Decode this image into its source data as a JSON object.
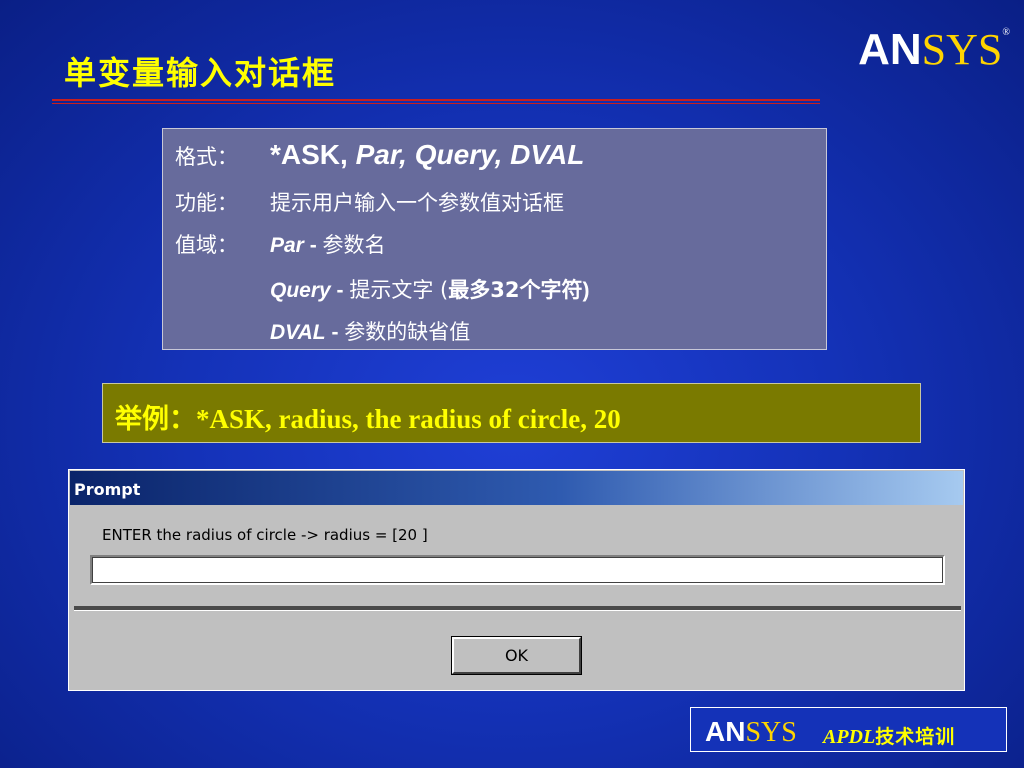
{
  "slide": {
    "title": "单变量输入对话框",
    "logo": {
      "an": "AN",
      "sys": "SYS",
      "mark": "®"
    }
  },
  "info": {
    "format_label": "格式：",
    "format_cmd": "*ASK,",
    "format_args": "Par, Query, DVAL",
    "function_label": "功能：",
    "function_text": "提示用户输入一个参数值对话框",
    "range_label": "值域：",
    "par_name": "Par",
    "par_sep": " - ",
    "par_desc": "参数名",
    "query_name": "Query",
    "query_sep": " - ",
    "query_desc": "提示文字 (",
    "query_desc_bold": "最多32个字符",
    "query_desc_end": ")",
    "dval_name": "DVAL",
    "dval_sep": " - ",
    "dval_desc": "参数的缺省值"
  },
  "example": {
    "label": "举例：",
    "text": "*ASK, radius, the radius of circle, 20"
  },
  "prompt": {
    "title": "Prompt",
    "label": "ENTER the radius of circle -> radius = [20 ]",
    "input_value": "",
    "ok_label": "OK"
  },
  "footer": {
    "logo_an": "AN",
    "logo_sys": "SYS",
    "apdl": "APDL",
    "text": "技术培训"
  }
}
